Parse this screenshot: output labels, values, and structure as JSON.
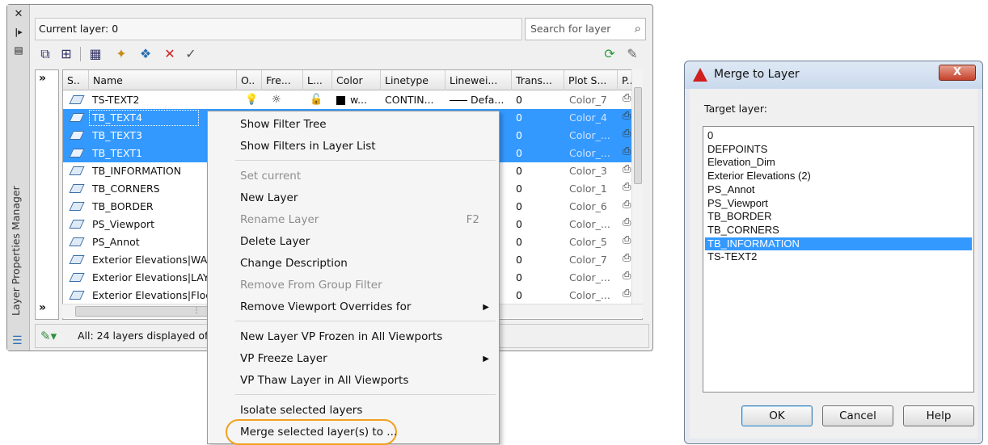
{
  "palette": {
    "side_title": "Layer Properties Manager",
    "current_layer": "Current layer: 0",
    "search_placeholder": "Search for layer",
    "filter_expand": "»",
    "columns": [
      "S..",
      "Name",
      "O..",
      "Fre...",
      "L...",
      "Color",
      "Linetype",
      "Linewei...",
      "Trans...",
      "Plot S...",
      "P.."
    ],
    "rows": [
      {
        "name": "TS-TEXT2",
        "selected": false,
        "color": "w...",
        "linetype": "CONTIN...",
        "lineweight": "Defa...",
        "trans": "0",
        "plot_style": "Color_7"
      },
      {
        "name": "TB_TEXT4",
        "selected": true,
        "trans": "0",
        "plot_style": "Color_4"
      },
      {
        "name": "TB_TEXT3",
        "selected": true,
        "trans": "0",
        "plot_style": "Color_..."
      },
      {
        "name": "TB_TEXT1",
        "selected": true,
        "trans": "0",
        "plot_style": "Color_..."
      },
      {
        "name": "TB_INFORMATION",
        "selected": false,
        "trans": "0",
        "plot_style": "Color_3"
      },
      {
        "name": "TB_CORNERS",
        "selected": false,
        "trans": "0",
        "plot_style": "Color_1"
      },
      {
        "name": "TB_BORDER",
        "selected": false,
        "trans": "0",
        "plot_style": "Color_6"
      },
      {
        "name": "PS_Viewport",
        "selected": false,
        "trans": "0",
        "plot_style": "Color_..."
      },
      {
        "name": "PS_Annot",
        "selected": false,
        "trans": "0",
        "plot_style": "Color_5"
      },
      {
        "name": "Exterior Elevations|WAL",
        "selected": false,
        "trans": "0",
        "plot_style": "Color_7"
      },
      {
        "name": "Exterior Elevations|LAYE",
        "selected": false,
        "trans": "0",
        "plot_style": "Color_..."
      },
      {
        "name": "Exterior Elevations|Floo",
        "selected": false,
        "trans": "0",
        "plot_style": "Color_..."
      }
    ],
    "status": "All: 24 layers displayed of"
  },
  "context_menu": {
    "items": [
      {
        "label": "Show Filter Tree",
        "disabled": false
      },
      {
        "label": "Show Filters in Layer List",
        "disabled": false
      },
      {
        "label": "Set current",
        "disabled": true
      },
      {
        "label": "New Layer",
        "disabled": false
      },
      {
        "label": "Rename Layer",
        "disabled": true,
        "shortcut": "F2"
      },
      {
        "label": "Delete Layer",
        "disabled": false
      },
      {
        "label": "Change Description",
        "disabled": false
      },
      {
        "label": "Remove From Group Filter",
        "disabled": true
      },
      {
        "label": "Remove Viewport Overrides for",
        "disabled": false,
        "submenu": true
      },
      {
        "label": "New Layer VP Frozen in All Viewports",
        "disabled": false
      },
      {
        "label": "VP Freeze Layer",
        "disabled": false,
        "submenu": true
      },
      {
        "label": "VP Thaw Layer in All Viewports",
        "disabled": false
      },
      {
        "label": "Isolate selected layers",
        "disabled": false
      },
      {
        "label": "Merge selected layer(s) to ...",
        "disabled": false,
        "highlighted": true
      }
    ]
  },
  "dialog": {
    "title": "Merge to Layer",
    "close": "X",
    "target_label": "Target layer:",
    "layers": [
      "0",
      "DEFPOINTS",
      "Elevation_Dim",
      "Exterior Elevations (2)",
      "PS_Annot",
      "PS_Viewport",
      "TB_BORDER",
      "TB_CORNERS",
      "TB_INFORMATION",
      "TS-TEXT2"
    ],
    "selected_layer": "TB_INFORMATION",
    "ok": "OK",
    "cancel": "Cancel",
    "help": "Help"
  },
  "colors": {
    "selection": "#3399ff",
    "highlight_oval": "#f0a020",
    "accent_red": "#d01f1f"
  }
}
